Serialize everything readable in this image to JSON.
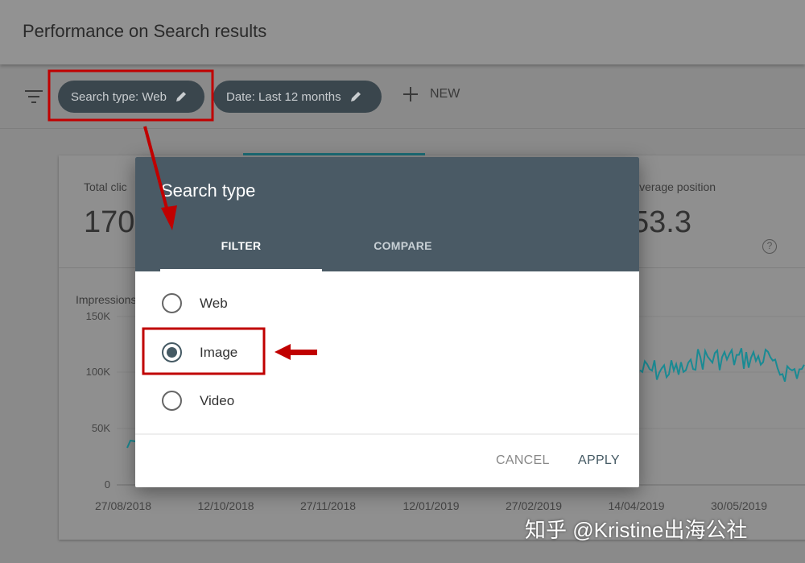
{
  "page": {
    "title": "Performance on Search results"
  },
  "filters": {
    "chips": [
      {
        "label": "Search type: Web",
        "icon": "pencil-icon"
      },
      {
        "label": "Date: Last 12 months",
        "icon": "pencil-icon"
      }
    ],
    "new_label": "NEW",
    "filter_icon": "filter-icon"
  },
  "metrics": {
    "total_clicks_label": "Total clic",
    "total_clicks_value": "170",
    "avg_position_label": "Average position",
    "avg_position_value": "53.3"
  },
  "chart": {
    "series_label": "Impressions",
    "y_ticks": [
      "150K",
      "100K",
      "50K",
      "0"
    ],
    "x_ticks": [
      "27/08/2018",
      "12/10/2018",
      "27/11/2018",
      "12/01/2019",
      "27/02/2019",
      "14/04/2019",
      "30/05/2019"
    ],
    "line_color": "#1a8a93"
  },
  "dialog": {
    "title": "Search type",
    "tabs": [
      "FILTER",
      "COMPARE"
    ],
    "active_tab": "FILTER",
    "options": [
      {
        "label": "Web",
        "selected": false
      },
      {
        "label": "Image",
        "selected": true
      },
      {
        "label": "Video",
        "selected": false
      }
    ],
    "cancel_label": "CANCEL",
    "apply_label": "APPLY"
  },
  "annotation_color": "#c00000",
  "watermark": "知乎 @Kristine出海公社"
}
